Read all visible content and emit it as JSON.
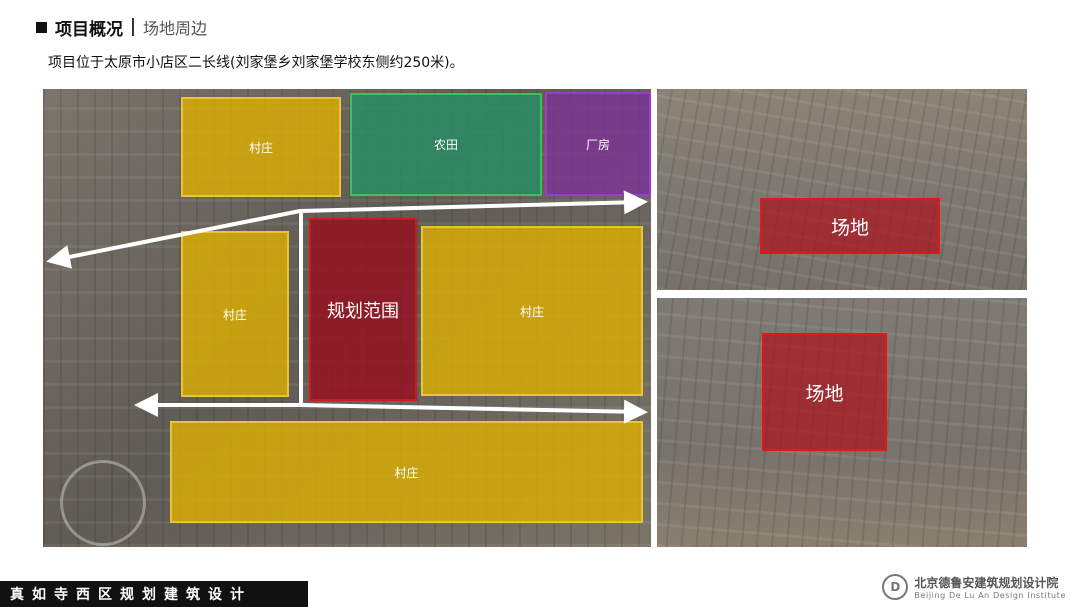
{
  "header": {
    "title": "项目概况",
    "subtitle": "场地周边"
  },
  "intro": "项目位于太原市小店区二长线(刘家堡乡刘家堡学校东侧约250米)。",
  "main_map": {
    "zones": {
      "village_top_left": "村庄",
      "farmland": "农田",
      "factory": "厂房",
      "village_mid_left": "村庄",
      "plan_area": "规划范围",
      "village_mid_right": "村庄",
      "village_bottom": "村庄"
    }
  },
  "photos": {
    "top_label": "场地",
    "bottom_label": "场地"
  },
  "footer": {
    "slogan": "真如寺西区规划建筑设计",
    "institute_cn": "北京德鲁安建筑规划设计院",
    "institute_en": "Beijing De Lu An Design Institute",
    "logo_letter": "D"
  },
  "colors": {
    "village": "#DEB000",
    "farmland": "#288C64",
    "factory": "#7D3296",
    "plan": "#960F1E",
    "site_border": "#E01818"
  }
}
